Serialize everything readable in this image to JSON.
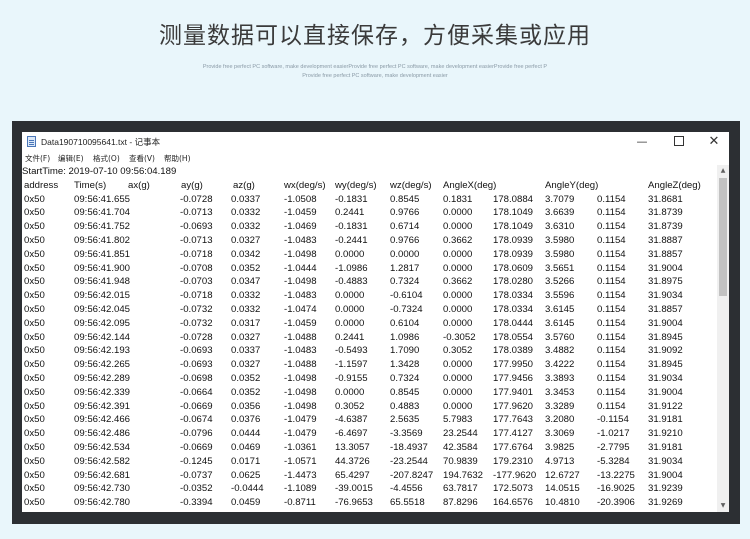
{
  "page": {
    "headline": "测量数据可以直接保存，方便采集或应用",
    "tagline1": "Provide free perfect PC software, make development easierProvide free perfect PC software, make development easierProvide free perfect P",
    "tagline2": "Provide free perfect PC software, make development easier"
  },
  "window": {
    "title": "Data190710095641.txt - 记事本",
    "minimize": "—",
    "close": "✕"
  },
  "menu": [
    "文件(F)",
    "编辑(E)",
    "格式(O)",
    "查看(V)",
    "帮助(H)"
  ],
  "file": {
    "start_line": "StartTime: 2019-07-10 09:56:04.189",
    "headers": [
      "address",
      "Time(s)",
      "ax(g)",
      "ay(g)",
      "az(g)",
      "wx(deg/s)",
      "wy(deg/s)",
      "wz(deg/s)",
      "AngleX(deg)",
      "AngleY(deg)",
      "AngleZ(deg)"
    ],
    "rows": [
      [
        "0x50",
        "09:56:41.655",
        "-0.0728",
        "0.0337",
        "-1.0508",
        "-0.1831",
        "0.8545",
        "0.1831",
        "178.0884",
        "3.7079",
        "0.1154",
        "31.8681"
      ],
      [
        "0x50",
        "09:56:41.704",
        "-0.0713",
        "0.0332",
        "-1.0459",
        "0.2441",
        "0.9766",
        "0.0000",
        "178.1049",
        "3.6639",
        "0.1154",
        "31.8739"
      ],
      [
        "0x50",
        "09:56:41.752",
        "-0.0693",
        "0.0332",
        "-1.0469",
        "-0.1831",
        "0.6714",
        "0.0000",
        "178.1049",
        "3.6310",
        "0.1154",
        "31.8739"
      ],
      [
        "0x50",
        "09:56:41.802",
        "-0.0713",
        "0.0327",
        "-1.0483",
        "-0.2441",
        "0.9766",
        "0.3662",
        "178.0939",
        "3.5980",
        "0.1154",
        "31.8887"
      ],
      [
        "0x50",
        "09:56:41.851",
        "-0.0718",
        "0.0342",
        "-1.0498",
        "0.0000",
        "0.0000",
        "0.0000",
        "178.0939",
        "3.5980",
        "0.1154",
        "31.8857"
      ],
      [
        "0x50",
        "09:56:41.900",
        "-0.0708",
        "0.0352",
        "-1.0444",
        "-1.0986",
        "1.2817",
        "0.0000",
        "178.0609",
        "3.5651",
        "0.1154",
        "31.9004"
      ],
      [
        "0x50",
        "09:56:41.948",
        "-0.0703",
        "0.0347",
        "-1.0498",
        "-0.4883",
        "0.7324",
        "0.3662",
        "178.0280",
        "3.5266",
        "0.1154",
        "31.8975"
      ],
      [
        "0x50",
        "09:56:42.015",
        "-0.0718",
        "0.0332",
        "-1.0483",
        "0.0000",
        "-0.6104",
        "0.0000",
        "178.0334",
        "3.5596",
        "0.1154",
        "31.9034"
      ],
      [
        "0x50",
        "09:56:42.045",
        "-0.0732",
        "0.0332",
        "-1.0474",
        "0.0000",
        "-0.7324",
        "0.0000",
        "178.0334",
        "3.6145",
        "0.1154",
        "31.8857"
      ],
      [
        "0x50",
        "09:56:42.095",
        "-0.0732",
        "0.0317",
        "-1.0459",
        "0.0000",
        "0.6104",
        "0.0000",
        "178.0444",
        "3.6145",
        "0.1154",
        "31.9004"
      ],
      [
        "0x50",
        "09:56:42.144",
        "-0.0728",
        "0.0327",
        "-1.0488",
        "0.2441",
        "1.0986",
        "-0.3052",
        "178.0554",
        "3.5760",
        "0.1154",
        "31.8945"
      ],
      [
        "0x50",
        "09:56:42.193",
        "-0.0693",
        "0.0337",
        "-1.0483",
        "-0.5493",
        "1.7090",
        "0.3052",
        "178.0389",
        "3.4882",
        "0.1154",
        "31.9092"
      ],
      [
        "0x50",
        "09:56:42.265",
        "-0.0693",
        "0.0327",
        "-1.0488",
        "-1.1597",
        "1.3428",
        "0.0000",
        "177.9950",
        "3.4222",
        "0.1154",
        "31.8945"
      ],
      [
        "0x50",
        "09:56:42.289",
        "-0.0698",
        "0.0352",
        "-1.0498",
        "-0.9155",
        "0.7324",
        "0.0000",
        "177.9456",
        "3.3893",
        "0.1154",
        "31.9034"
      ],
      [
        "0x50",
        "09:56:42.339",
        "-0.0664",
        "0.0352",
        "-1.0498",
        "0.0000",
        "0.8545",
        "0.0000",
        "177.9401",
        "3.3453",
        "0.1154",
        "31.9004"
      ],
      [
        "0x50",
        "09:56:42.391",
        "-0.0669",
        "0.0356",
        "-1.0498",
        "0.3052",
        "0.4883",
        "0.0000",
        "177.9620",
        "3.3289",
        "0.1154",
        "31.9122"
      ],
      [
        "0x50",
        "09:56:42.466",
        "-0.0674",
        "0.0376",
        "-1.0479",
        "-4.6387",
        "2.5635",
        "5.7983",
        "177.7643",
        "3.2080",
        "-0.1154",
        "31.9181"
      ],
      [
        "0x50",
        "09:56:42.486",
        "-0.0796",
        "0.0444",
        "-1.0479",
        "-6.4697",
        "-3.3569",
        "23.2544",
        "177.4127",
        "3.3069",
        "-1.0217",
        "31.9210"
      ],
      [
        "0x50",
        "09:56:42.534",
        "-0.0669",
        "0.0469",
        "-1.0361",
        "13.3057",
        "-18.4937",
        "42.3584",
        "177.6764",
        "3.9825",
        "-2.7795",
        "31.9181"
      ],
      [
        "0x50",
        "09:56:42.582",
        "-0.1245",
        "0.0171",
        "-1.0571",
        "44.3726",
        "-23.2544",
        "70.9839",
        "179.2310",
        "4.9713",
        "-5.3284",
        "31.9034"
      ],
      [
        "0x50",
        "09:56:42.681",
        "-0.0737",
        "0.0625",
        "-1.4473",
        "65.4297",
        "-207.8247",
        "194.7632",
        "-177.9620",
        "12.6727",
        "-13.2275",
        "31.9004"
      ],
      [
        "0x50",
        "09:56:42.730",
        "-0.0352",
        "-0.0444",
        "-1.1089",
        "-39.0015",
        "-4.4556",
        "63.7817",
        "172.5073",
        "14.0515",
        "-16.9025",
        "31.9239"
      ],
      [
        "0x50",
        "09:56:42.780",
        "-0.3394",
        "0.0459",
        "-0.8711",
        "-76.9653",
        "65.5518",
        "87.8296",
        "164.6576",
        "10.4810",
        "-20.3906",
        "31.9269"
      ]
    ]
  }
}
